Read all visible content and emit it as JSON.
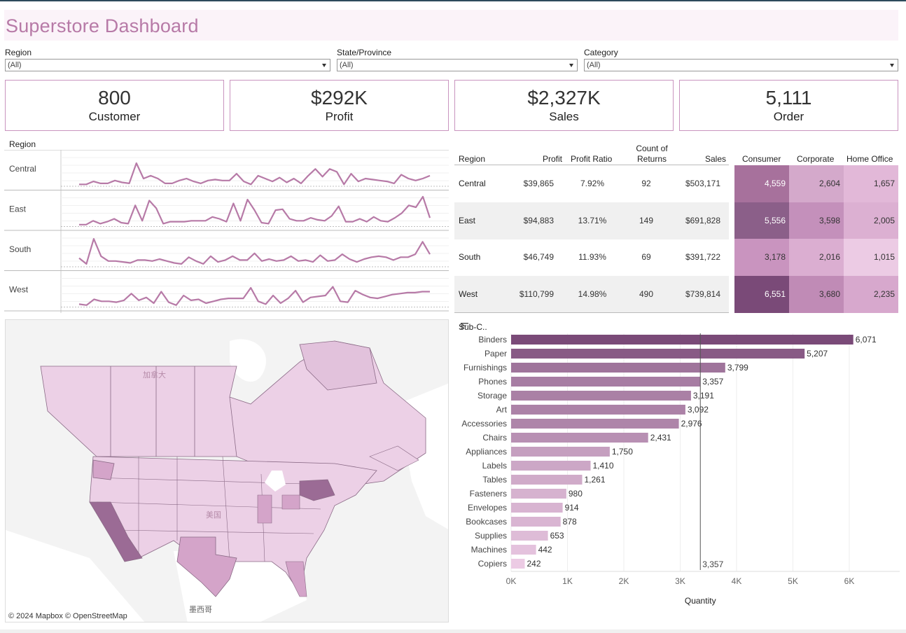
{
  "dashboard": {
    "title": "Superstore Dashboard"
  },
  "filters": [
    {
      "label": "Region",
      "value": "(All)"
    },
    {
      "label": "State/Province",
      "value": "(All)"
    },
    {
      "label": "Category",
      "value": "(All)"
    }
  ],
  "kpis": [
    {
      "value": "800",
      "label": "Customer"
    },
    {
      "value": "$292K",
      "label": "Profit"
    },
    {
      "value": "$2,327K",
      "label": "Sales"
    },
    {
      "value": "5,111",
      "label": "Order"
    }
  ],
  "sparklines": {
    "header": "Region",
    "color": "#b77aa7",
    "regions": [
      {
        "name": "Central",
        "values": [
          2,
          2,
          5,
          3,
          3,
          6,
          4,
          3,
          24,
          8,
          11,
          8,
          3,
          3,
          6,
          8,
          5,
          3,
          6,
          7,
          6,
          6,
          13,
          5,
          2,
          11,
          8,
          5,
          9,
          4,
          8,
          3,
          11,
          18,
          10,
          18,
          15,
          2,
          13,
          5,
          8,
          7,
          6,
          5,
          3,
          12,
          8,
          6,
          8,
          11
        ]
      },
      {
        "name": "East",
        "values": [
          2,
          2,
          6,
          3,
          5,
          8,
          4,
          3,
          22,
          6,
          27,
          19,
          3,
          5,
          5,
          5,
          6,
          6,
          6,
          10,
          8,
          5,
          24,
          6,
          28,
          17,
          4,
          3,
          17,
          18,
          8,
          6,
          6,
          9,
          7,
          6,
          11,
          21,
          5,
          5,
          8,
          5,
          10,
          6,
          5,
          9,
          14,
          22,
          20,
          31,
          9
        ]
      },
      {
        "name": "South",
        "values": [
          9,
          3,
          29,
          11,
          6,
          6,
          5,
          4,
          7,
          7,
          6,
          8,
          6,
          4,
          3,
          10,
          6,
          3,
          11,
          5,
          7,
          11,
          7,
          7,
          14,
          6,
          8,
          6,
          7,
          11,
          6,
          7,
          5,
          12,
          6,
          7,
          13,
          8,
          5,
          8,
          10,
          11,
          10,
          7,
          10,
          10,
          13,
          26,
          13
        ]
      },
      {
        "name": "West",
        "values": [
          3,
          2,
          8,
          6,
          6,
          5,
          7,
          14,
          7,
          10,
          4,
          16,
          5,
          2,
          12,
          7,
          8,
          4,
          6,
          8,
          9,
          9,
          9,
          20,
          6,
          3,
          12,
          4,
          9,
          17,
          5,
          10,
          11,
          12,
          21,
          6,
          5,
          17,
          13,
          10,
          9,
          11,
          13,
          14,
          15,
          15,
          16,
          16
        ]
      }
    ]
  },
  "region_table": {
    "headers": {
      "region": "Region",
      "profit": "Profit",
      "ratio": "Profit Ratio",
      "returns": "Count of Returns",
      "sales": "Sales"
    },
    "rows": [
      {
        "region": "Central",
        "profit": "$39,865",
        "ratio": "7.92%",
        "returns": "92",
        "sales": "$503,171"
      },
      {
        "region": "East",
        "profit": "$94,883",
        "ratio": "13.71%",
        "returns": "149",
        "sales": "$691,828"
      },
      {
        "region": "South",
        "profit": "$46,749",
        "ratio": "11.93%",
        "returns": "69",
        "sales": "$391,722"
      },
      {
        "region": "West",
        "profit": "$110,799",
        "ratio": "14.98%",
        "returns": "490",
        "sales": "$739,814"
      }
    ]
  },
  "segment_heatmap": {
    "headers": [
      "Consumer",
      "Corporate",
      "Home Office"
    ],
    "rows": [
      {
        "region": "Central",
        "values": [
          "4,559",
          "2,604",
          "1,657"
        ],
        "colors": [
          "#a7719c",
          "#d4a9cb",
          "#e2b8d8"
        ],
        "text": [
          "#fff",
          "#333",
          "#333"
        ]
      },
      {
        "region": "East",
        "values": [
          "5,556",
          "3,598",
          "2,005"
        ],
        "colors": [
          "#8b5f89",
          "#c490bb",
          "#dcb0d2"
        ],
        "text": [
          "#fff",
          "#333",
          "#333"
        ]
      },
      {
        "region": "South",
        "values": [
          "3,178",
          "2,016",
          "1,015"
        ],
        "colors": [
          "#c994bf",
          "#dbaed1",
          "#eccbe4"
        ],
        "text": [
          "#333",
          "#333",
          "#333"
        ]
      },
      {
        "region": "West",
        "values": [
          "6,551",
          "3,680",
          "2,235"
        ],
        "colors": [
          "#7a4a78",
          "#c08bb6",
          "#d7a8cd"
        ],
        "text": [
          "#fff",
          "#333",
          "#333"
        ]
      }
    ]
  },
  "map": {
    "copyright": "© 2024 Mapbox  © OpenStreetMap",
    "labels": [
      "加拿大",
      "美国",
      "墨西哥"
    ],
    "colors": {
      "base": "#ecd0e6",
      "mid": "#d4a4c9",
      "high": "#9b6b95",
      "land": "#e6e6e6",
      "water": "#ffffff",
      "border": "#8a6a86"
    }
  },
  "chart_data": {
    "type": "bar",
    "orientation": "horizontal",
    "header": "Sub-C..",
    "xlabel": "Quantity",
    "xlim": [
      0,
      6500
    ],
    "xticks": [
      "0K",
      "1K",
      "2K",
      "3K",
      "4K",
      "5K",
      "6K"
    ],
    "reference_line": {
      "value": 3357,
      "label": "3,357"
    },
    "categories": [
      "Binders",
      "Paper",
      "Furnishings",
      "Phones",
      "Storage",
      "Art",
      "Accessories",
      "Chairs",
      "Appliances",
      "Labels",
      "Tables",
      "Fasteners",
      "Envelopes",
      "Bookcases",
      "Supplies",
      "Machines",
      "Copiers"
    ],
    "values": [
      6071,
      5207,
      3799,
      3357,
      3191,
      3092,
      2976,
      2431,
      1750,
      1410,
      1261,
      980,
      914,
      878,
      653,
      442,
      242
    ],
    "labels": [
      "6,071",
      "5,207",
      "3,799",
      "3,357",
      "3,191",
      "3,092",
      "2,976",
      "2,431",
      "1,750",
      "1,410",
      "1,261",
      "980",
      "914",
      "878",
      "653",
      "442",
      "242"
    ],
    "color_low": "#eccbe4",
    "color_high": "#7a4a78"
  }
}
